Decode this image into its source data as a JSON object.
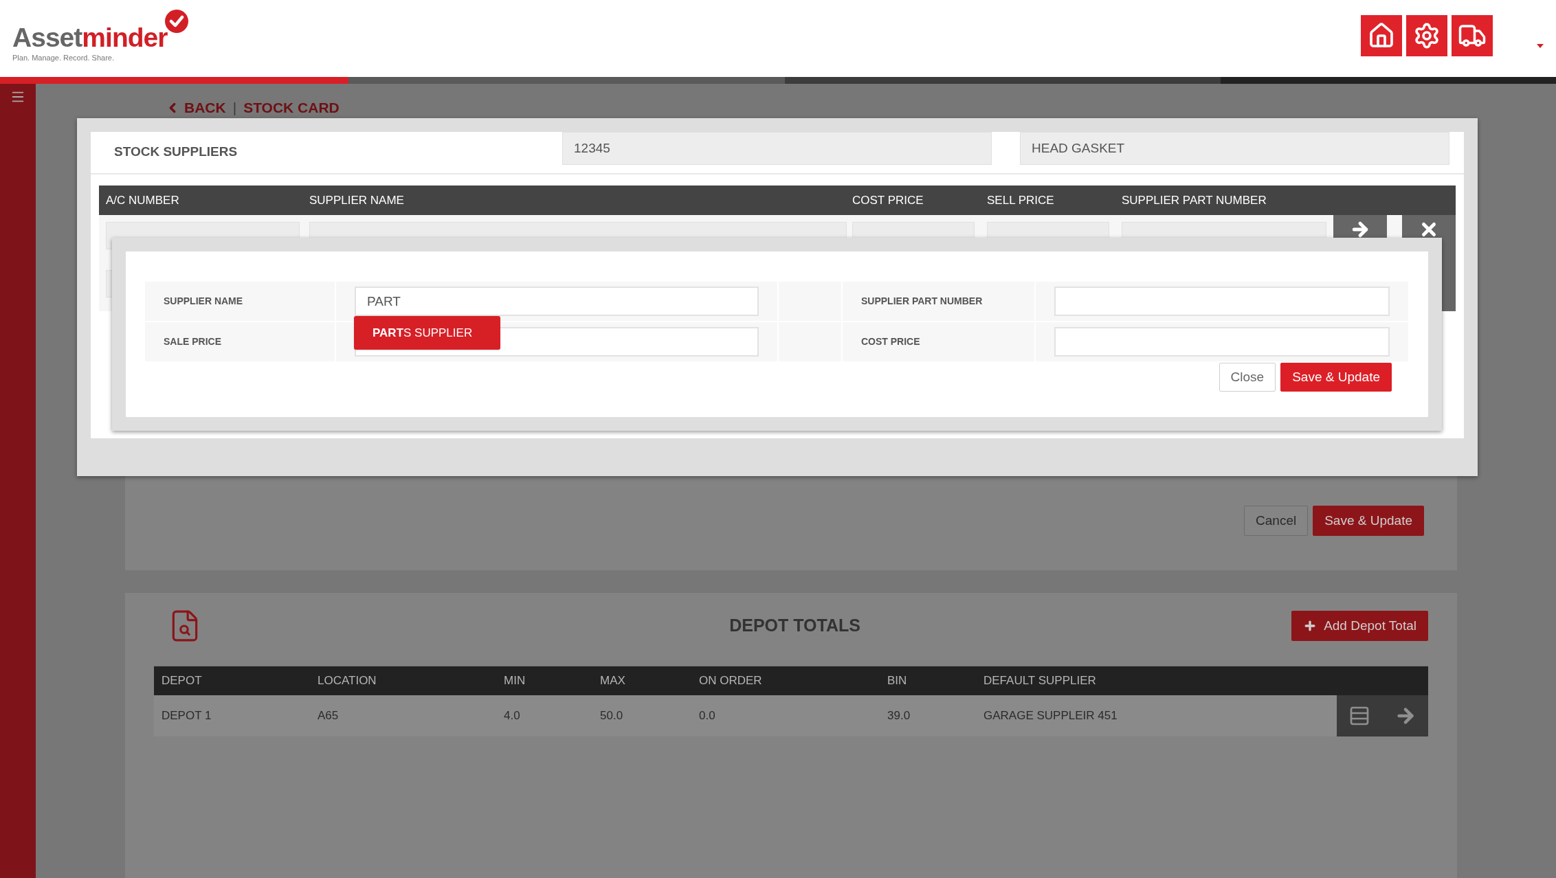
{
  "header": {
    "logo": {
      "text_start": "Asset",
      "text_end": "minder",
      "tagline": "Plan. Manage. Record. Share."
    }
  },
  "breadcrumb": {
    "back": "BACK",
    "separator": "|",
    "current": "STOCK CARD"
  },
  "stock_form": {
    "buttons": [
      {
        "label": "Cancel",
        "kind": "secondary"
      },
      {
        "label": "Save & Update",
        "kind": "primary"
      }
    ]
  },
  "depot_totals": {
    "title": "DEPOT TOTALS",
    "add_button": "Add Depot Total",
    "columns": [
      "DEPOT",
      "LOCATION",
      "MIN",
      "MAX",
      "ON ORDER",
      "BIN",
      "DEFAULT SUPPLIER"
    ],
    "rows": [
      {
        "cells": [
          "DEPOT 1",
          "A65",
          "4.0",
          "50.0",
          "0.0",
          "39.0",
          "GARAGE SUPPLEIR 451"
        ]
      }
    ]
  },
  "stock_suppliers_dialog": {
    "title": "STOCK SUPPLIERS",
    "stock_code": "12345",
    "description": "HEAD GASKET",
    "columns": [
      "A/C NUMBER",
      "SUPPLIER NAME",
      "COST PRICE",
      "SELL PRICE",
      "SUPPLIER PART NUMBER"
    ]
  },
  "edit_supplier_dialog": {
    "fields": [
      {
        "label": "SUPPLIER NAME",
        "value": "PART"
      },
      {
        "label": "SUPPLIER PART NUMBER"
      },
      {
        "label": "SALE PRICE"
      },
      {
        "label": "COST PRICE"
      }
    ],
    "suggestion": "**PART**S SUPPLIER",
    "buttons": [
      {
        "label": "Close",
        "kind": "secondary"
      },
      {
        "label": "Save & Update",
        "kind": "primary"
      }
    ]
  }
}
